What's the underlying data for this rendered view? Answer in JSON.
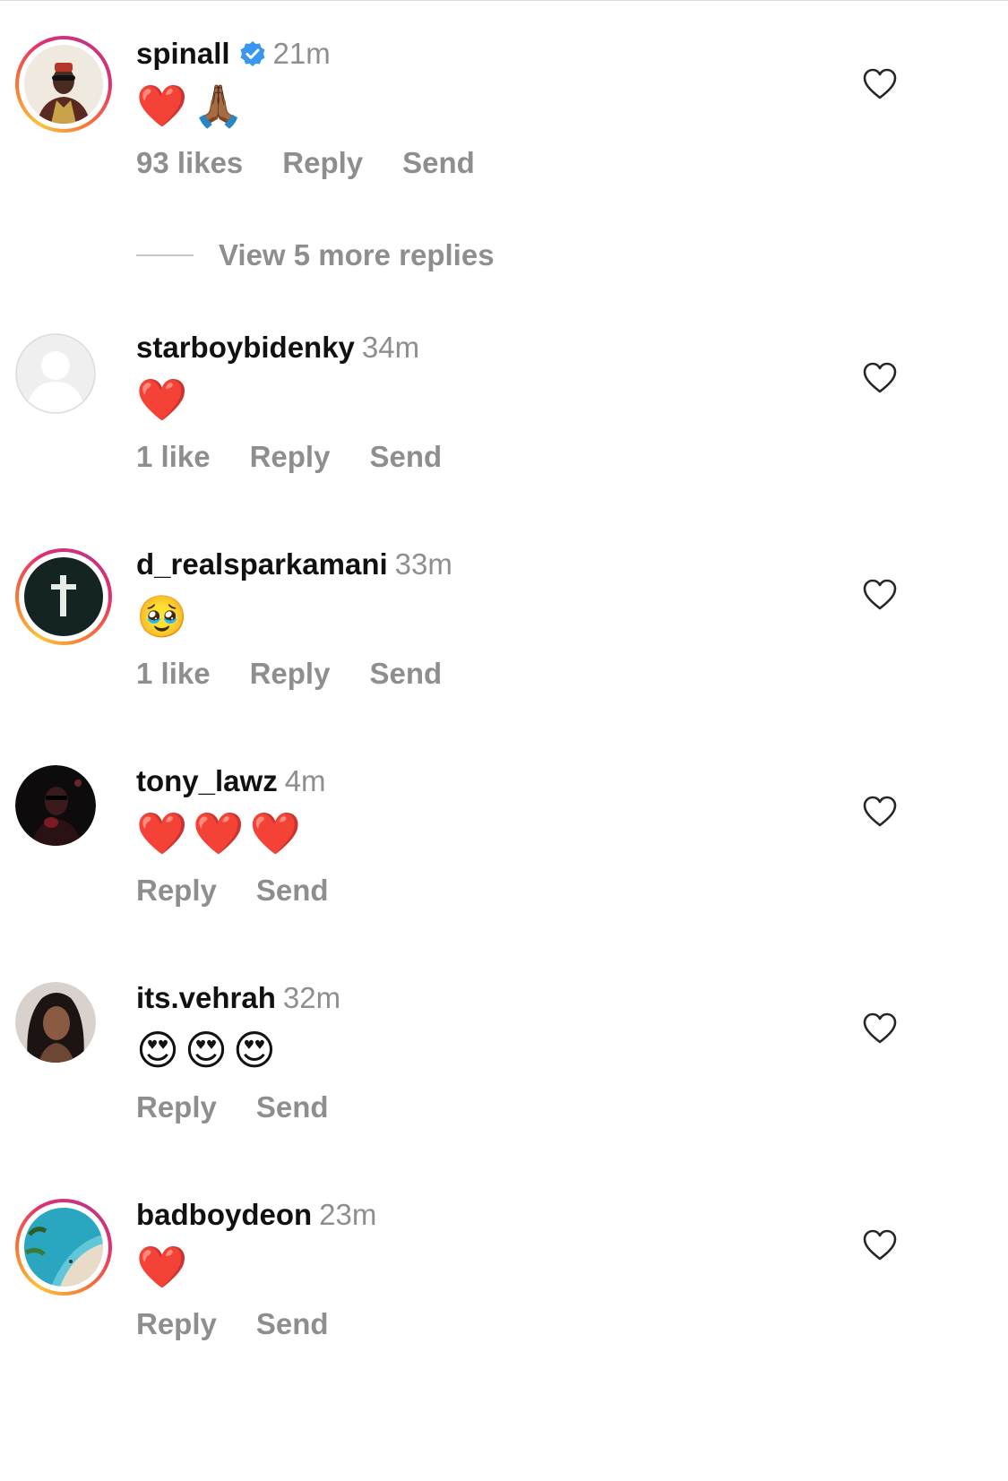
{
  "comments": [
    {
      "username": "spinall",
      "verified": true,
      "time": "21m",
      "text": "❤️🙏🏾",
      "likes": "93 likes",
      "reply": "Reply",
      "send": "Send",
      "ring": true
    },
    {
      "username": "starboybidenky",
      "verified": false,
      "time": "34m",
      "text": "❤️",
      "likes": "1 like",
      "reply": "Reply",
      "send": "Send",
      "ring": false
    },
    {
      "username": "d_realsparkamani",
      "verified": false,
      "time": "33m",
      "text": "🥹",
      "likes": "1 like",
      "reply": "Reply",
      "send": "Send",
      "ring": true
    },
    {
      "username": "tony_lawz",
      "verified": false,
      "time": "4m",
      "text": "❤️❤️❤️",
      "likes": "",
      "reply": "Reply",
      "send": "Send",
      "ring": false
    },
    {
      "username": "its.vehrah",
      "verified": false,
      "time": "32m",
      "text": "😍😍😍",
      "likes": "",
      "reply": "Reply",
      "send": "Send",
      "ring": false
    },
    {
      "username": "badboydeon",
      "verified": false,
      "time": "23m",
      "text": "❤️",
      "likes": "",
      "reply": "Reply",
      "send": "Send",
      "ring": true
    }
  ],
  "view_more": "View 5 more replies",
  "colors": {
    "muted": "#8e8e8e",
    "verified": "#3897f0",
    "heart": "#262626"
  }
}
